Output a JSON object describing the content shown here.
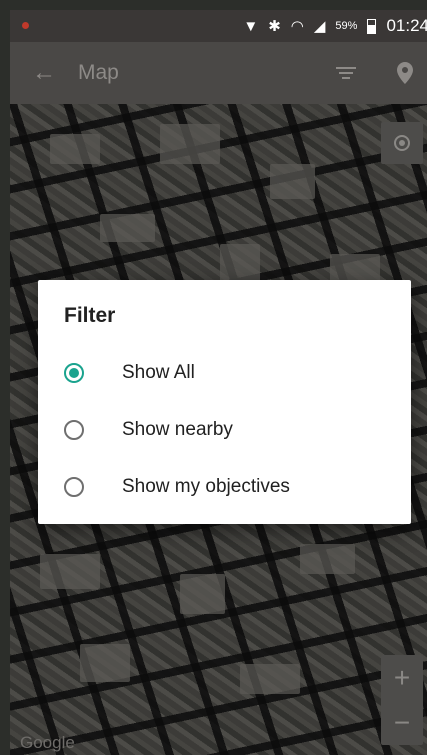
{
  "status_bar": {
    "battery_percent": "59%",
    "time": "01:24"
  },
  "toolbar": {
    "title": "Map"
  },
  "map": {
    "attribution": "Google",
    "zoom_in": "+",
    "zoom_out": "−"
  },
  "dialog": {
    "title": "Filter",
    "options": [
      {
        "label": "Show All",
        "selected": true
      },
      {
        "label": "Show nearby",
        "selected": false
      },
      {
        "label": "Show my objectives",
        "selected": false
      }
    ]
  },
  "colors": {
    "accent": "#1aa38e",
    "toolbar": "#4a4846",
    "status_bar": "#3a3736"
  }
}
